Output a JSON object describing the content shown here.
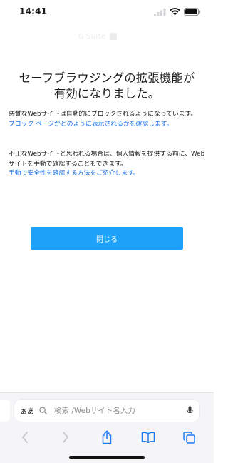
{
  "status_bar": {
    "time": "14:41"
  },
  "logo_text": "G Suite",
  "page": {
    "title_line1": "セーフブラウジングの拡張機能が",
    "title_line2": "有効になりました。",
    "para1_text": "悪質なWebサイトは自動的にブロックされるようになっています。",
    "para1_link": "ブロック ページがどのように表示されるかを確認します。",
    "para2_text": "不正なWebサイトと思われる場合は、個人情報を提供する前に、Webサイトを手動で確認することもできます。",
    "para2_link": "手動で安全性を確認する方法をご紹介します。",
    "close_label": "閉じる"
  },
  "browser": {
    "aa_label": "ぁあ",
    "address_placeholder": "検索 /Webサイト名入力"
  },
  "colors": {
    "accent": "#1ea1f8",
    "link": "#1a73e8",
    "toolbar_icon": "#1a7cf5"
  }
}
